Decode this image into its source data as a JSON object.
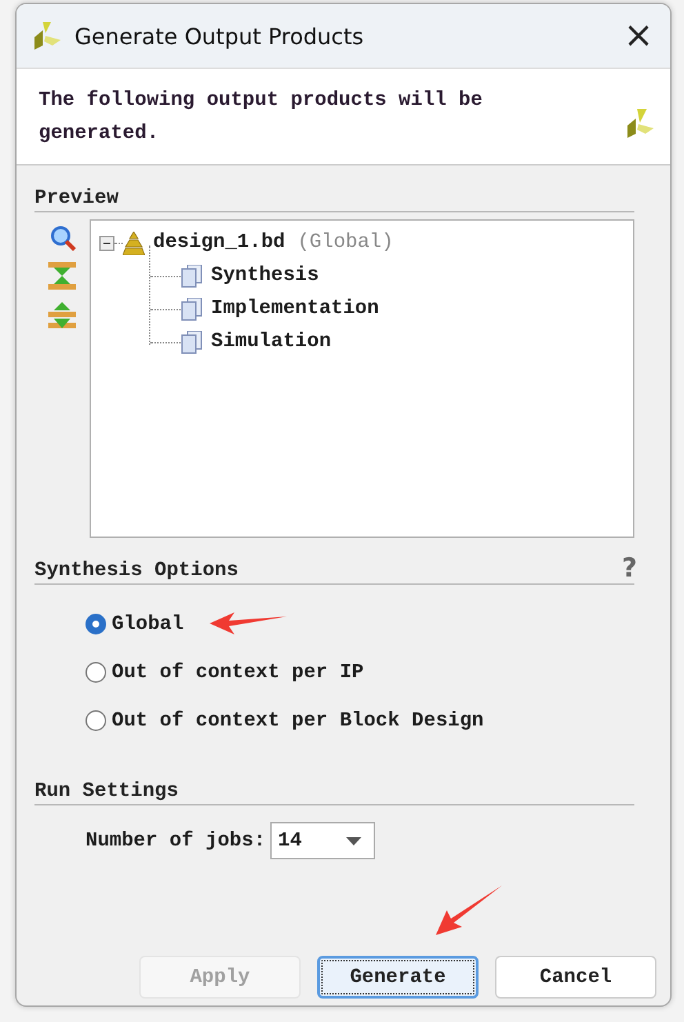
{
  "window": {
    "title": "Generate Output Products",
    "close": "×"
  },
  "header": {
    "message": "The following output products will be generated."
  },
  "preview": {
    "label": "Preview",
    "tree": [
      {
        "label": "design_1.bd",
        "note": "(Global)",
        "expanded": true,
        "children": [
          {
            "label": "Synthesis"
          },
          {
            "label": "Implementation"
          },
          {
            "label": "Simulation"
          }
        ]
      }
    ]
  },
  "synthesis_options": {
    "label": "Synthesis Options",
    "help": "?",
    "options": [
      {
        "label": "Global",
        "selected": true
      },
      {
        "label": "Out of context per IP",
        "selected": false
      },
      {
        "label": "Out of context per Block Design",
        "selected": false
      }
    ]
  },
  "run_settings": {
    "label": "Run Settings",
    "jobs_label": "Number of jobs:",
    "jobs_value": "14"
  },
  "buttons": [
    {
      "label": "Apply",
      "disabled": true,
      "focused": false
    },
    {
      "label": "Generate",
      "disabled": false,
      "focused": true
    },
    {
      "label": "Cancel",
      "disabled": false,
      "focused": false
    }
  ]
}
